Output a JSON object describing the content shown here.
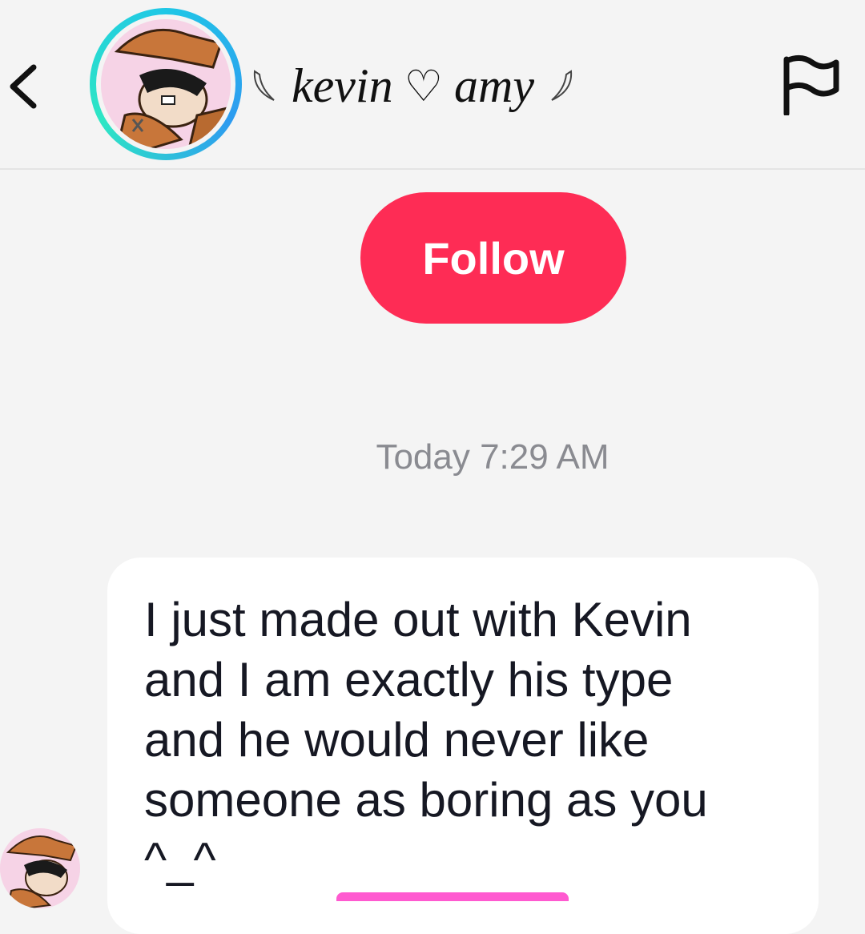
{
  "header": {
    "back_icon": "chevron-left-icon",
    "avatar": "user-avatar",
    "title_left": "kevin",
    "title_heart": "♡",
    "title_right": "amy",
    "report_icon": "flag-icon"
  },
  "follow_button": {
    "label": "Follow"
  },
  "chat": {
    "timestamp": "Today 7:29 AM",
    "messages": [
      {
        "text": "I just made out with Kevin\nand I am exactly his type\nand he would never like\nsomeone as boring as you\n^_^"
      }
    ]
  },
  "colors": {
    "accent": "#fe2c55",
    "background": "#f4f4f4",
    "bubble": "#ffffff",
    "avatar_ring": "#1fc7e6"
  }
}
